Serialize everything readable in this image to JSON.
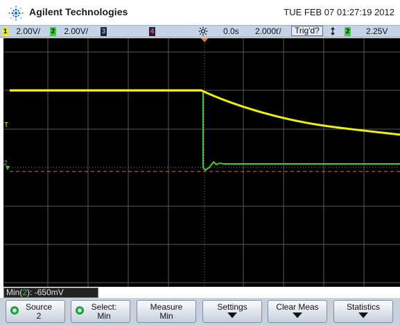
{
  "header": {
    "brand": "Agilent Technologies",
    "datetime": "TUE FEB 07 01:27:19 2012"
  },
  "status": {
    "ch1_num": "1",
    "ch1_scale": "2.00V/",
    "ch2_num": "2",
    "ch2_scale": "2.00V/",
    "ch3_num": "3",
    "ch4_num": "4",
    "trig_icon": "sun-trigger-icon",
    "time_delay": "0.0s",
    "timebase": "2.000ť/",
    "trigger_state": "Trig'd?",
    "trig_edge_icon": "trigger-edge-icon",
    "trig_source": "2",
    "trig_level": "2.25V",
    "colors": {
      "ch1": "#f2f200",
      "ch2": "#39d139",
      "ch3": "#6fa6ff",
      "ch4": "#ff4aa5",
      "grid": "#5a5a5a",
      "marker": "#ff6a1a"
    }
  },
  "measurement": {
    "prefix": "Min(",
    "channel": "2",
    "suffix": "): -650mV"
  },
  "softkeys": [
    {
      "label": "Source",
      "value": "2"
    },
    {
      "label": "Select:",
      "value": "Min"
    },
    {
      "label": "Measure",
      "value": "Min"
    },
    {
      "label": "Settings",
      "value": ""
    },
    {
      "label": "Clear Meas",
      "value": ""
    },
    {
      "label": "Statistics",
      "value": ""
    }
  ]
}
